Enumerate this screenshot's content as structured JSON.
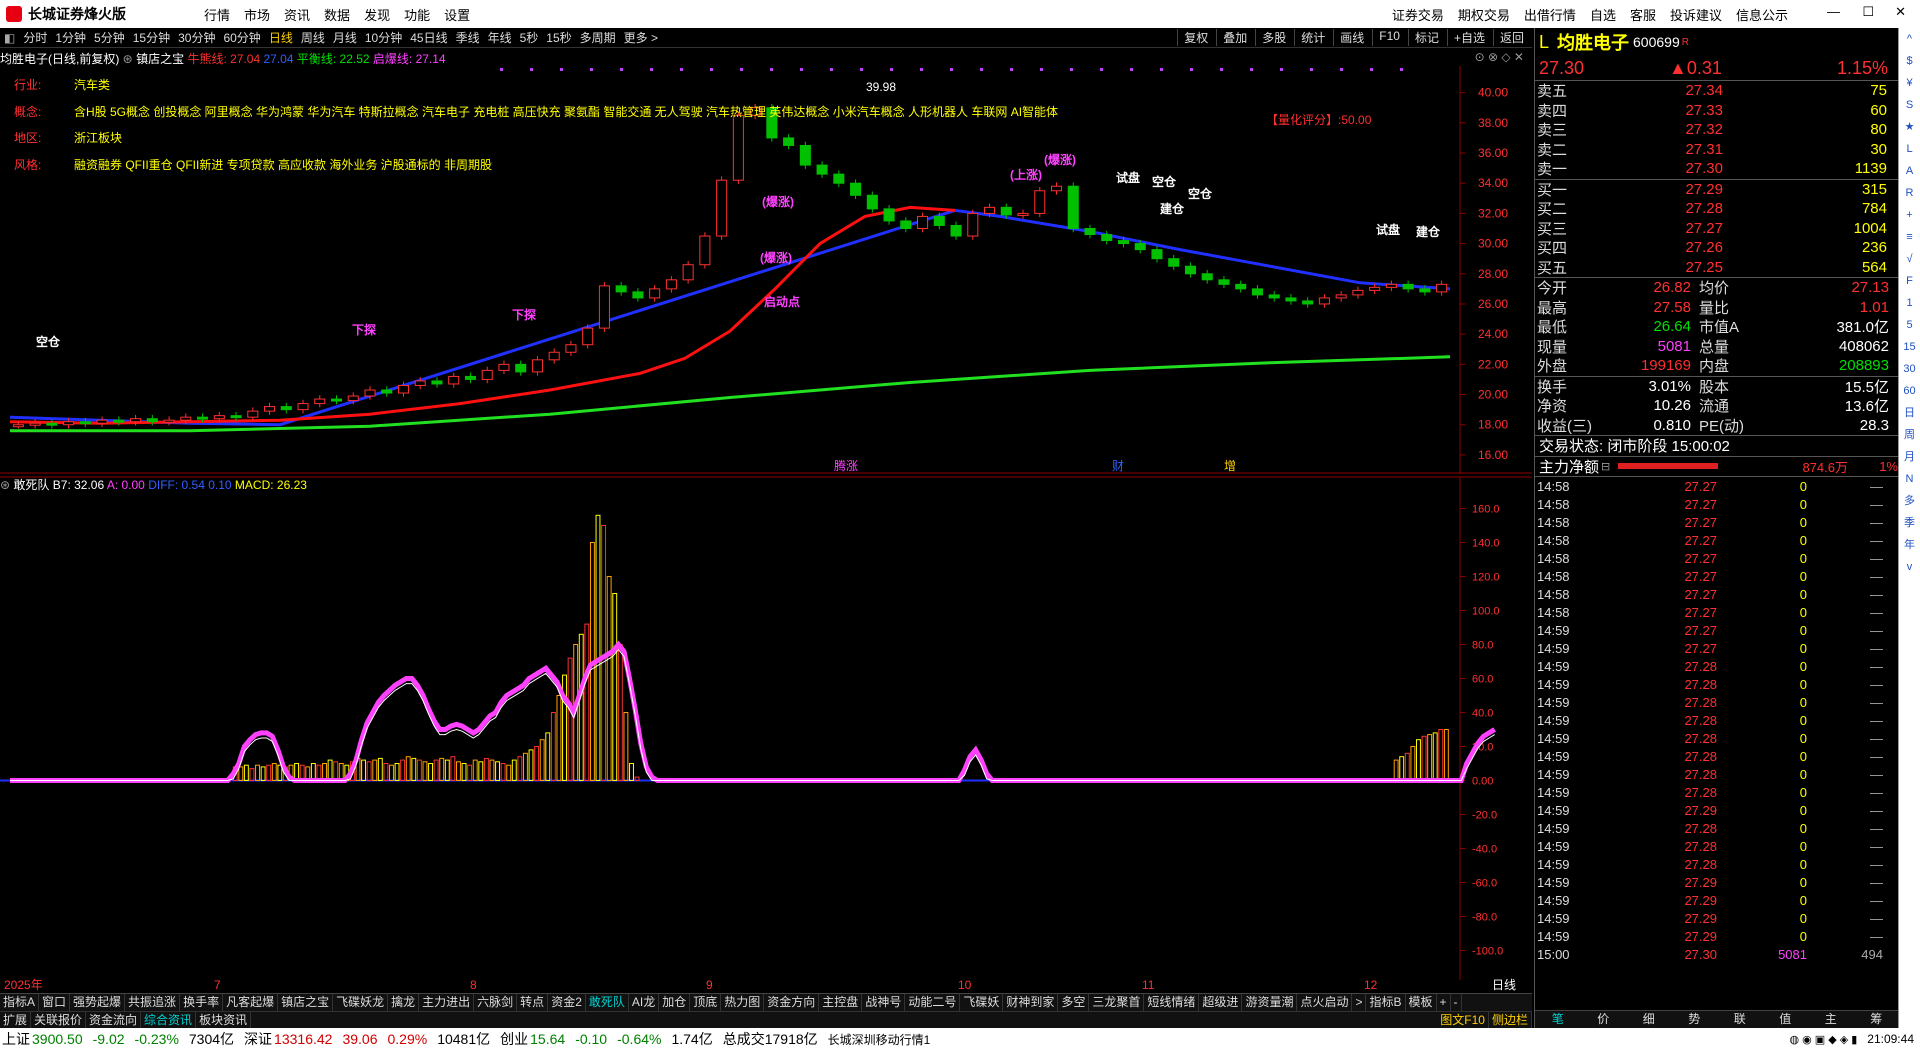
{
  "app": {
    "title": "长城证券烽火版"
  },
  "menu": [
    "行情",
    "市场",
    "资讯",
    "数据",
    "发现",
    "功能",
    "设置"
  ],
  "menu_right": [
    "证券交易",
    "期权交易",
    "出借行情",
    "自选",
    "客服",
    "投诉建议",
    "信息公示"
  ],
  "periods": [
    "分时",
    "1分钟",
    "5分钟",
    "15分钟",
    "30分钟",
    "60分钟",
    "日线",
    "周线",
    "月线",
    "10分钟",
    "45日线",
    "季线",
    "年线",
    "5秒",
    "15秒",
    "多周期",
    "更多 >"
  ],
  "period_active": "日线",
  "toolbar_right": [
    "复权",
    "叠加",
    "多股",
    "统计",
    "画线",
    "F10",
    "标记",
    "+自选",
    "返回"
  ],
  "infobar": {
    "stock_title": "均胜电子(日线,前复权)",
    "indicator": "镇店之宝",
    "line1": "牛熊线: 27.04",
    "line2": "27.04",
    "line3": "平衡线: 22.52",
    "line4": "启爆线: 27.14"
  },
  "annotations": {
    "industry_label": "行业:",
    "industry_value": "汽车类",
    "concept_label": "概念:",
    "concept_value": "含H股 5G概念 创投概念 阿里概念 华为鸿蒙 华为汽车 特斯拉概念 汽车电子 充电桩 高压快充 聚氨酯 智能交通 无人驾驶 汽车热管理 英伟达概念 小米汽车概念 人形机器人 车联网 AI智能体",
    "region_label": "地区:",
    "region_value": "浙江板块",
    "style_label": "风格:",
    "style_value": "融资融券 QFII重仓 QFII新进 专项贷款 高应收款 海外业务 沪股通标的 非周期股",
    "score": "【量化评分】:50.00"
  },
  "chart_labels": {
    "high": "39.98",
    "signals": [
      "空仓",
      "(上涨)",
      "试盘",
      "空仓",
      "空仓",
      "建仓",
      "(爆涨)",
      "(爆涨)",
      "(爆涨)",
      "下探",
      "下探",
      "启动点",
      "试盘",
      "建仓"
    ],
    "events": [
      "腾涨",
      "财",
      "增"
    ]
  },
  "price_axis": [
    "40.00",
    "38.00",
    "36.00",
    "34.00",
    "32.00",
    "30.00",
    "28.00",
    "26.00",
    "24.00",
    "22.00",
    "20.00",
    "18.00",
    "16.00"
  ],
  "sub_indicator": {
    "name": "敢死队",
    "b7": "B7: 32.06",
    "a": "A: 0.00",
    "diff": "DIFF: 0.54",
    "dea": "0.10",
    "macd": "MACD: 26.23"
  },
  "sub_axis": [
    "160.0",
    "140.0",
    "120.0",
    "100.0",
    "80.0",
    "60.0",
    "40.0",
    "20.0",
    "0.00",
    "-20.0",
    "-40.0",
    "-60.0",
    "-80.0",
    "-100.0"
  ],
  "date_axis": [
    "2025年",
    "7",
    "8",
    "9",
    "10",
    "11",
    "12"
  ],
  "date_right": "日线",
  "tabs1": [
    "指标A",
    "窗口",
    "强势起爆",
    "共振追涨",
    "换手率",
    "凡客起爆",
    "镇店之宝",
    "飞碟妖龙",
    "擒龙",
    "主力进出",
    "六脉剑",
    "转点",
    "资金2",
    "敢死队",
    "AI龙",
    "加仓",
    "顶底",
    "热力图",
    "资金方向",
    "主控盘",
    "战神号",
    "动能二号",
    "飞碟妖",
    "财神到家",
    "多空",
    "三龙聚首",
    "短线情绪",
    "超级进",
    "游资量潮",
    "点火启动",
    ">",
    "指标B",
    "模板",
    "+",
    "-"
  ],
  "tabs1_active": "敢死队",
  "tabs2": [
    "扩展",
    "关联报价",
    "资金流向",
    "综合资讯",
    "板块资讯"
  ],
  "tabs2_active": "综合资讯",
  "tabs2_right": [
    "图文F10",
    "侧边栏"
  ],
  "quote": {
    "name": "均胜电子",
    "code": "600699",
    "badge": "R",
    "price": "27.30",
    "change": "▲0.31",
    "pct": "1.15%",
    "asks": [
      {
        "label": "卖五",
        "price": "27.34",
        "vol": "75"
      },
      {
        "label": "卖四",
        "price": "27.33",
        "vol": "60"
      },
      {
        "label": "卖三",
        "price": "27.32",
        "vol": "80"
      },
      {
        "label": "卖二",
        "price": "27.31",
        "vol": "30"
      },
      {
        "label": "卖一",
        "price": "27.30",
        "vol": "1139"
      }
    ],
    "bids": [
      {
        "label": "买一",
        "price": "27.29",
        "vol": "315"
      },
      {
        "label": "买二",
        "price": "27.28",
        "vol": "784"
      },
      {
        "label": "买三",
        "price": "27.27",
        "vol": "1004"
      },
      {
        "label": "买四",
        "price": "27.26",
        "vol": "236"
      },
      {
        "label": "买五",
        "price": "27.25",
        "vol": "564"
      }
    ],
    "stats": [
      {
        "l1": "今开",
        "v1": "26.82",
        "c1": "r",
        "l2": "均价",
        "v2": "27.13",
        "c2": "r"
      },
      {
        "l1": "最高",
        "v1": "27.58",
        "c1": "r",
        "l2": "量比",
        "v2": "1.01",
        "c2": "r"
      },
      {
        "l1": "最低",
        "v1": "26.64",
        "c1": "g",
        "l2": "市值A",
        "v2": "381.0亿",
        "c2": "w"
      },
      {
        "l1": "现量",
        "v1": "5081",
        "c1": "m",
        "l2": "总量",
        "v2": "408062",
        "c2": "w"
      },
      {
        "l1": "外盘",
        "v1": "199169",
        "c1": "r",
        "l2": "内盘",
        "v2": "208893",
        "c2": "g"
      }
    ],
    "stats2": [
      {
        "l1": "换手",
        "v1": "3.01%",
        "l2": "股本",
        "v2": "15.5亿"
      },
      {
        "l1": "净资",
        "v1": "10.26",
        "l2": "流通",
        "v2": "13.6亿"
      },
      {
        "l1": "收益(三)",
        "v1": "0.810",
        "l2": "PE(动)",
        "v2": "28.3"
      }
    ],
    "trade_status": "交易状态: 闭市阶段 15:00:02",
    "main_flow_label": "主力净额",
    "main_flow_value": "874.6万",
    "main_flow_pct": "1%"
  },
  "ticks": [
    {
      "t": "14:58",
      "p": "27.27",
      "v": "0",
      "d": "—"
    },
    {
      "t": "14:58",
      "p": "27.27",
      "v": "0",
      "d": "—"
    },
    {
      "t": "14:58",
      "p": "27.27",
      "v": "0",
      "d": "—"
    },
    {
      "t": "14:58",
      "p": "27.27",
      "v": "0",
      "d": "—"
    },
    {
      "t": "14:58",
      "p": "27.27",
      "v": "0",
      "d": "—"
    },
    {
      "t": "14:58",
      "p": "27.27",
      "v": "0",
      "d": "—"
    },
    {
      "t": "14:58",
      "p": "27.27",
      "v": "0",
      "d": "—"
    },
    {
      "t": "14:58",
      "p": "27.27",
      "v": "0",
      "d": "—"
    },
    {
      "t": "14:59",
      "p": "27.27",
      "v": "0",
      "d": "—"
    },
    {
      "t": "14:59",
      "p": "27.27",
      "v": "0",
      "d": "—"
    },
    {
      "t": "14:59",
      "p": "27.28",
      "v": "0",
      "d": "—"
    },
    {
      "t": "14:59",
      "p": "27.28",
      "v": "0",
      "d": "—"
    },
    {
      "t": "14:59",
      "p": "27.28",
      "v": "0",
      "d": "—"
    },
    {
      "t": "14:59",
      "p": "27.28",
      "v": "0",
      "d": "—"
    },
    {
      "t": "14:59",
      "p": "27.28",
      "v": "0",
      "d": "—"
    },
    {
      "t": "14:59",
      "p": "27.28",
      "v": "0",
      "d": "—"
    },
    {
      "t": "14:59",
      "p": "27.28",
      "v": "0",
      "d": "—"
    },
    {
      "t": "14:59",
      "p": "27.28",
      "v": "0",
      "d": "—"
    },
    {
      "t": "14:59",
      "p": "27.29",
      "v": "0",
      "d": "—"
    },
    {
      "t": "14:59",
      "p": "27.28",
      "v": "0",
      "d": "—"
    },
    {
      "t": "14:59",
      "p": "27.28",
      "v": "0",
      "d": "—"
    },
    {
      "t": "14:59",
      "p": "27.28",
      "v": "0",
      "d": "—"
    },
    {
      "t": "14:59",
      "p": "27.29",
      "v": "0",
      "d": "—"
    },
    {
      "t": "14:59",
      "p": "27.29",
      "v": "0",
      "d": "—"
    },
    {
      "t": "14:59",
      "p": "27.29",
      "v": "0",
      "d": "—"
    },
    {
      "t": "14:59",
      "p": "27.29",
      "v": "0",
      "d": "—"
    },
    {
      "t": "15:00",
      "p": "27.30",
      "v": "5081",
      "d": "494"
    }
  ],
  "rtabs": [
    "笔",
    "价",
    "细",
    "势",
    "联",
    "值",
    "主",
    "筹"
  ],
  "rtabs_active": "笔",
  "rtoolbar": [
    "^",
    "$",
    "¥",
    "S",
    "★",
    "L",
    "A",
    "R",
    "+",
    "≡",
    "√",
    "F",
    "1",
    "5",
    "15",
    "30",
    "60",
    "日",
    "周",
    "月",
    "N",
    "多",
    "季",
    "年",
    "v"
  ],
  "status": {
    "sh_label": "上证",
    "sh_val": "3900.50",
    "sh_chg": "-9.02",
    "sh_pct": "-0.23%",
    "sh_amt": "7304亿",
    "sz_label": "深证",
    "sz_val": "13316.42",
    "sz_chg": "39.06",
    "sz_pct": "0.29%",
    "sz_amt": "10481亿",
    "cy_label": "创业",
    "cy_val": "15.64",
    "cy_chg": "-0.10",
    "cy_pct": "-0.64%",
    "cy_amt": "1.74亿",
    "total": "总成交17918亿",
    "server": "长城深圳移动行情1",
    "time": "21:09:44"
  },
  "colors": {
    "red": "#ff3030",
    "green": "#00e000",
    "blue": "#2030ff",
    "magenta": "#ff40ff",
    "yellow": "#ffff00"
  },
  "chart_data": [
    {
      "type": "candlestick",
      "title": "均胜电子(日线,前复权)",
      "ylim": [
        15.0,
        41.5
      ],
      "ma_red": [
        [
          0,
          18.2
        ],
        [
          20,
          18.1
        ],
        [
          40,
          18.2
        ],
        [
          60,
          18.3
        ],
        [
          80,
          18.7
        ],
        [
          100,
          19.4
        ],
        [
          120,
          20.3
        ],
        [
          140,
          21.4
        ],
        [
          150,
          22.4
        ],
        [
          160,
          24.2
        ],
        [
          170,
          27.0
        ],
        [
          180,
          30.0
        ],
        [
          190,
          31.8
        ],
        [
          200,
          32.4
        ],
        [
          210,
          32.2
        ]
      ],
      "ma_blue": [
        [
          0,
          18.5
        ],
        [
          20,
          18.3
        ],
        [
          40,
          18.1
        ],
        [
          60,
          18.0
        ],
        [
          210,
          32.2
        ],
        [
          220,
          31.8
        ],
        [
          240,
          30.8
        ],
        [
          260,
          29.6
        ],
        [
          280,
          28.5
        ],
        [
          300,
          27.4
        ],
        [
          320,
          27.0
        ]
      ],
      "ma_green": [
        [
          0,
          17.6
        ],
        [
          40,
          17.6
        ],
        [
          80,
          17.9
        ],
        [
          120,
          18.7
        ],
        [
          160,
          19.8
        ],
        [
          200,
          20.8
        ],
        [
          240,
          21.6
        ],
        [
          280,
          22.1
        ],
        [
          320,
          22.5
        ]
      ],
      "candles_close": [
        18.0,
        18.1,
        18.0,
        18.2,
        18.1,
        18.3,
        18.2,
        18.4,
        18.2,
        18.3,
        18.5,
        18.4,
        18.6,
        18.5,
        18.9,
        19.2,
        19.0,
        19.4,
        19.7,
        19.6,
        19.9,
        20.3,
        20.1,
        20.6,
        20.9,
        20.7,
        21.2,
        21.0,
        21.6,
        22.0,
        21.5,
        22.3,
        22.8,
        23.3,
        24.4,
        27.2,
        26.8,
        26.4,
        27.0,
        27.6,
        28.6,
        30.5,
        34.2,
        38.5,
        39.0,
        37.0,
        36.5,
        35.2,
        34.6,
        34.0,
        33.2,
        32.3,
        31.5,
        31.0,
        31.8,
        31.2,
        30.5,
        32.0,
        32.4,
        31.9,
        32.0,
        33.5,
        33.8,
        31.0,
        30.6,
        30.2,
        30.0,
        29.6,
        29.0,
        28.5,
        28.0,
        27.6,
        27.3,
        27.0,
        26.6,
        26.4,
        26.2,
        26.0,
        26.4,
        26.6,
        26.9,
        27.1,
        27.3,
        27.0,
        26.8,
        27.3
      ]
    },
    {
      "type": "bar",
      "title": "敢死队",
      "ylim": [
        -115,
        165
      ],
      "bars": [
        0,
        0,
        0,
        0,
        0,
        0,
        0,
        0,
        0,
        0,
        0,
        0,
        0,
        0,
        0,
        0,
        0,
        0,
        0,
        0,
        0,
        0,
        0,
        0,
        0,
        0,
        0,
        0,
        0,
        0,
        0,
        0,
        0,
        0,
        0,
        0,
        0,
        0,
        0,
        0,
        8,
        8,
        9,
        7,
        9,
        8,
        9,
        10,
        9,
        8,
        9,
        10,
        9,
        8,
        10,
        9,
        10,
        12,
        11,
        10,
        9,
        11,
        13,
        12,
        11,
        12,
        13,
        10,
        9,
        10,
        12,
        14,
        13,
        12,
        11,
        10,
        12,
        13,
        12,
        14,
        11,
        10,
        9,
        12,
        11,
        13,
        12,
        11,
        10,
        9,
        12,
        14,
        16,
        18,
        20,
        24,
        28,
        40,
        50,
        62,
        72,
        80,
        86,
        92,
        140,
        156,
        150,
        120,
        110,
        80,
        40,
        10,
        2,
        0,
        0,
        0,
        0,
        0,
        0,
        0,
        0,
        0,
        0,
        0,
        0,
        0,
        0,
        0,
        0,
        0,
        0,
        0,
        0,
        0,
        0,
        0,
        0,
        0,
        0,
        0,
        0,
        0,
        0,
        0,
        0,
        0,
        0,
        0,
        0,
        0,
        0,
        0,
        0,
        0,
        0,
        0,
        0,
        0,
        0,
        0,
        0,
        0,
        0,
        0,
        0,
        0,
        0,
        0,
        0,
        0,
        0,
        0,
        0,
        0,
        0,
        0,
        0,
        0,
        0,
        0,
        0,
        0,
        0,
        0,
        0,
        0,
        0,
        0,
        0,
        0,
        0,
        0,
        0,
        0,
        0,
        0,
        0,
        0,
        0,
        0,
        0,
        0,
        0,
        0,
        0,
        0,
        0,
        0,
        0,
        0,
        0,
        0,
        0,
        0,
        0,
        0,
        0,
        0,
        0,
        0,
        0,
        0,
        0,
        0,
        0,
        0,
        0,
        0,
        0,
        0,
        0,
        0,
        0,
        0,
        0,
        0,
        0,
        0,
        0,
        0,
        0,
        0,
        0,
        0,
        0,
        0,
        0,
        0,
        12,
        14,
        16,
        20,
        24,
        26,
        27,
        28,
        30,
        30
      ],
      "magenta_line": [
        0,
        0,
        0,
        0,
        0,
        0,
        0,
        0,
        0,
        0,
        0,
        0,
        0,
        0,
        0,
        0,
        0,
        0,
        0,
        0,
        0,
        0,
        0,
        0,
        0,
        0,
        0,
        0,
        0,
        0,
        0,
        0,
        0,
        0,
        0,
        0,
        0,
        0,
        0,
        0,
        4,
        10,
        20,
        24,
        27,
        28,
        28,
        26,
        18,
        8,
        2,
        0,
        0,
        0,
        0,
        0,
        0,
        0,
        0,
        0,
        0,
        4,
        12,
        24,
        34,
        40,
        46,
        50,
        53,
        56,
        58,
        60,
        60,
        56,
        50,
        42,
        35,
        30,
        30,
        32,
        33,
        32,
        30,
        28,
        30,
        34,
        38,
        40,
        46,
        50,
        52,
        54,
        56,
        60,
        62,
        64,
        66,
        62,
        58,
        50,
        46,
        40,
        50,
        60,
        68,
        70,
        72,
        74,
        76,
        80,
        76,
        60,
        42,
        22,
        8,
        2,
        0,
        0,
        0,
        0,
        0,
        0,
        0,
        0,
        0,
        0,
        0,
        0,
        0,
        0,
        0,
        0,
        0,
        0,
        0,
        0,
        0,
        0,
        0,
        0,
        0,
        0,
        0,
        0,
        0,
        0,
        0,
        0,
        0,
        0,
        0,
        0,
        0,
        0,
        0,
        0,
        0,
        0,
        0,
        0,
        0,
        0,
        0,
        0,
        0,
        0,
        0,
        0,
        0,
        0,
        0,
        6,
        14,
        18,
        12,
        4,
        0,
        0,
        0,
        0,
        0,
        0,
        0,
        0,
        0,
        0,
        0,
        0,
        0,
        0,
        0,
        0,
        0,
        0,
        0,
        0,
        0,
        0,
        0,
        0,
        0,
        0,
        0,
        0,
        0,
        0,
        0,
        0,
        0,
        0,
        0,
        0,
        0,
        0,
        0,
        0,
        0,
        0,
        0,
        0,
        0,
        0,
        0,
        0,
        0,
        0,
        0,
        0,
        0,
        0,
        0,
        0,
        0,
        0,
        0,
        0,
        0,
        0,
        0,
        0,
        0,
        0,
        0,
        0,
        0,
        0,
        0,
        0,
        0,
        0,
        0,
        0,
        0,
        0,
        0,
        0,
        0,
        0,
        0,
        0,
        0,
        10,
        16,
        22,
        26,
        28,
        30
      ]
    }
  ]
}
